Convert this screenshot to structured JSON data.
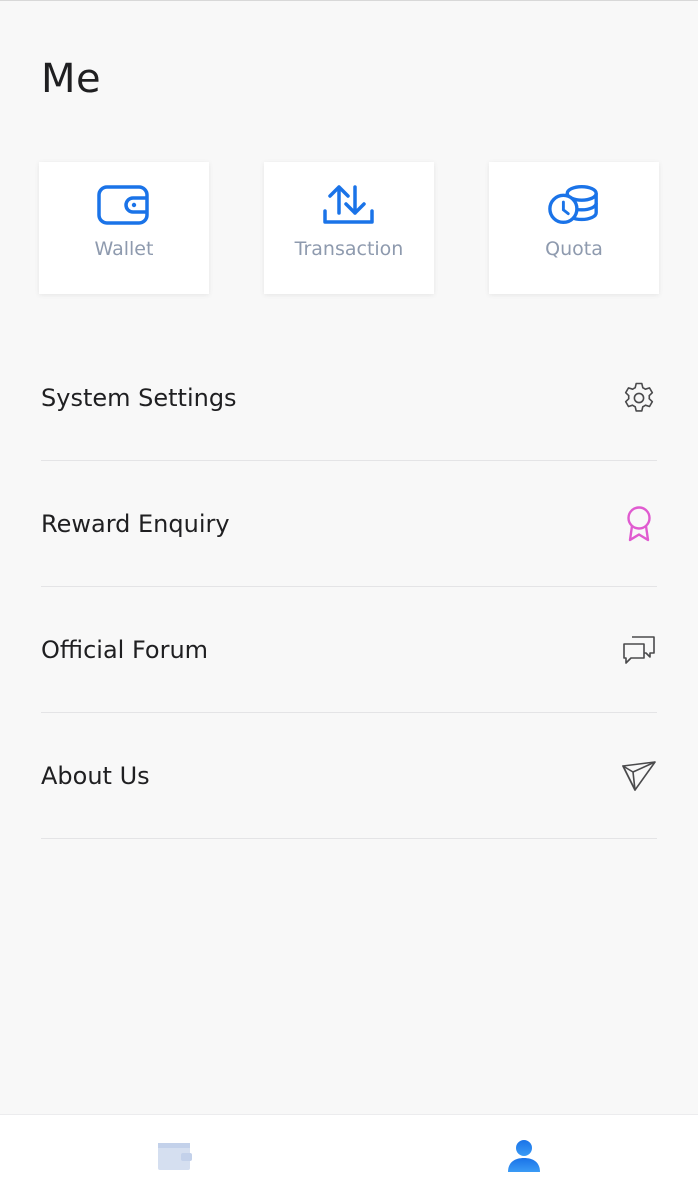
{
  "page": {
    "title": "Me"
  },
  "cards": [
    {
      "label": "Wallet",
      "icon": "wallet-icon"
    },
    {
      "label": "Transaction",
      "icon": "transfer-arrows-icon"
    },
    {
      "label": "Quota",
      "icon": "coins-clock-icon"
    }
  ],
  "menu": [
    {
      "label": "System Settings",
      "icon": "gear-icon"
    },
    {
      "label": "Reward Enquiry",
      "icon": "award-ribbon-icon"
    },
    {
      "label": "Official Forum",
      "icon": "chat-bubbles-icon"
    },
    {
      "label": "About Us",
      "icon": "paper-plane-icon"
    }
  ],
  "tabbar": {
    "tabs": [
      {
        "icon": "wallet-tab-icon",
        "active": false
      },
      {
        "icon": "person-icon",
        "active": true
      }
    ]
  },
  "colors": {
    "accent": "#1a73e8",
    "card_label": "#8e9aae",
    "reward_icon": "#e05bd0",
    "inactive_tab": "#d5dff0",
    "background": "#f8f8f8"
  }
}
